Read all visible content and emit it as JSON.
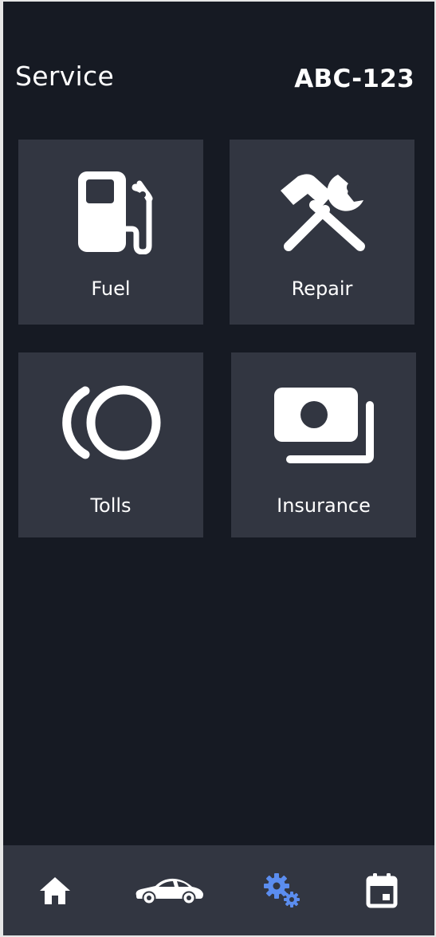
{
  "header": {
    "title": "Service",
    "plate": "ABC-123"
  },
  "tiles": [
    {
      "label": "Fuel",
      "icon": "fuel-pump-icon"
    },
    {
      "label": "Repair",
      "icon": "hammer-wrench-icon"
    },
    {
      "label": "Tolls",
      "icon": "toll-coin-icon"
    },
    {
      "label": "Insurance",
      "icon": "money-icon"
    }
  ],
  "nav": {
    "items": [
      {
        "icon": "home-icon",
        "active": false
      },
      {
        "icon": "car-icon",
        "active": false
      },
      {
        "icon": "gears-icon",
        "active": true
      },
      {
        "icon": "calendar-icon",
        "active": false
      }
    ],
    "active_color": "#5b8def",
    "inactive_color": "#ffffff"
  },
  "colors": {
    "background": "#161a23",
    "tile": "#323641",
    "text": "#ffffff"
  }
}
